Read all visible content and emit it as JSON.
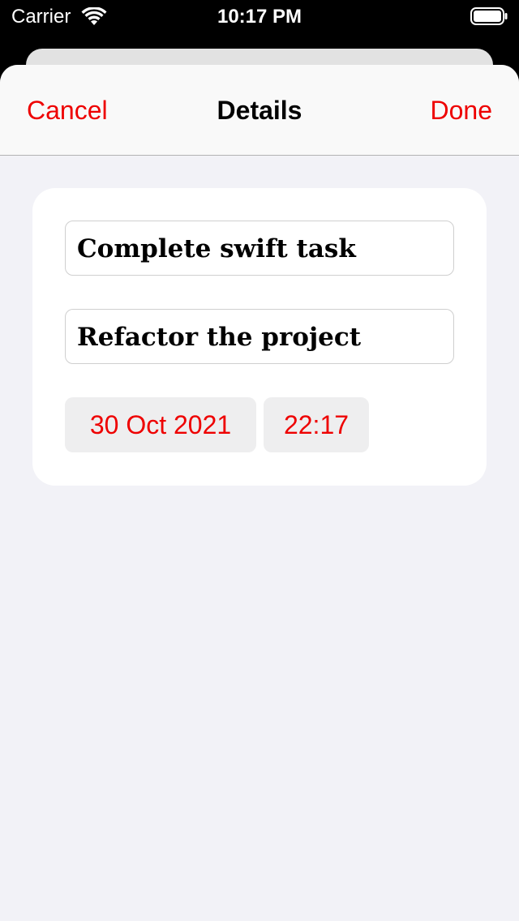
{
  "status_bar": {
    "carrier": "Carrier",
    "time": "10:17 PM",
    "wifi_icon": "wifi-icon",
    "battery_icon": "battery-icon"
  },
  "nav": {
    "cancel_label": "Cancel",
    "title": "Details",
    "done_label": "Done"
  },
  "form": {
    "title_value": "Complete swift task",
    "notes_value": "Refactor the project",
    "date_value": "30 Oct 2021",
    "time_value": "22:17"
  },
  "colors": {
    "accent": "#ee0000",
    "sheet_background": "#f2f2f7",
    "card_background": "#ffffff"
  }
}
